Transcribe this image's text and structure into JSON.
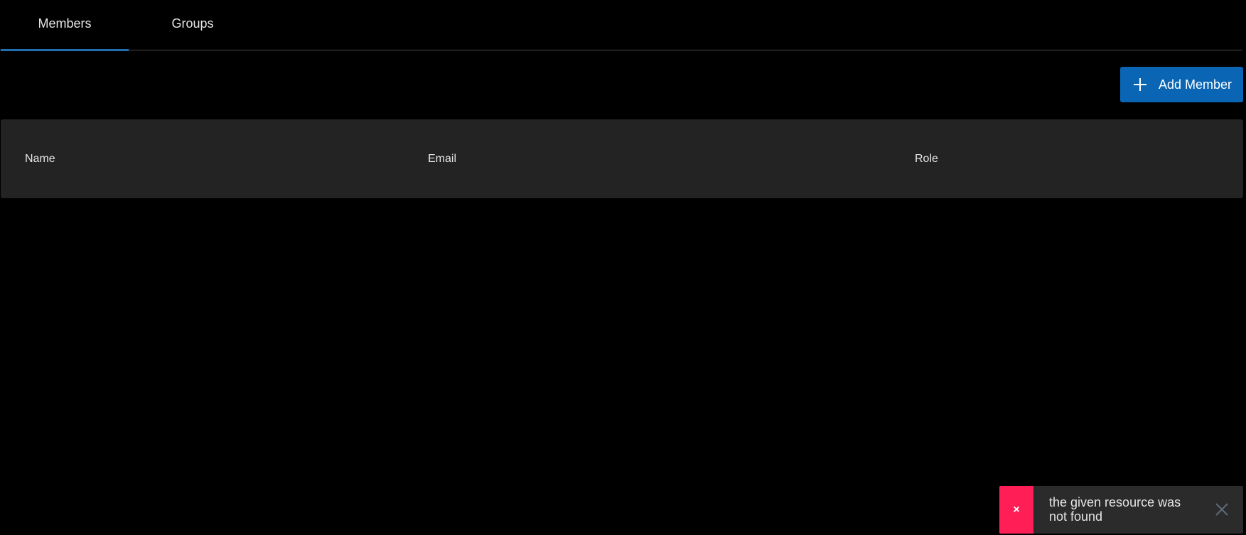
{
  "tabs": [
    {
      "label": "Members",
      "active": true
    },
    {
      "label": "Groups",
      "active": false
    }
  ],
  "toolbar": {
    "add_member_label": "Add Member",
    "add_member_icon": "plus-icon"
  },
  "table": {
    "columns": [
      "Name",
      "Email",
      "Role"
    ],
    "rows": []
  },
  "toast": {
    "status_glyph": "×",
    "status_icon": "error-x-icon",
    "message": "the given resource was not found",
    "close_icon": "close-icon",
    "status_color": "#ff1f56"
  },
  "colors": {
    "accent": "#0a66b4",
    "tab_indicator": "#1f6fb5",
    "header_bg": "#232323",
    "toast_bg": "#2b2b2b"
  }
}
